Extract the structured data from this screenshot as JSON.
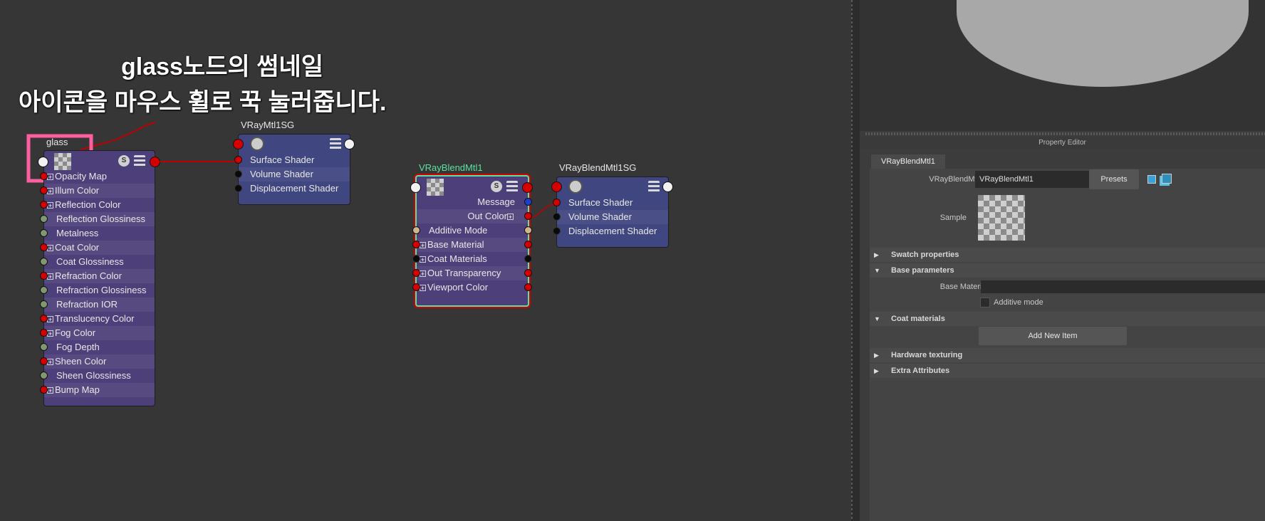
{
  "annotation": {
    "line1": "glass노드의 썸네일",
    "line2": "아이콘을 마우스 휠로 꾹 눌러줍니다."
  },
  "nodes": {
    "glass": {
      "title": "glass",
      "attrs": [
        {
          "label": "Opacity Map",
          "plug": "red",
          "expand": true
        },
        {
          "label": "Illum Color",
          "plug": "red",
          "expand": true
        },
        {
          "label": "Reflection Color",
          "plug": "red",
          "expand": true
        },
        {
          "label": "Reflection Glossiness",
          "plug": "grey",
          "expand": false
        },
        {
          "label": "Metalness",
          "plug": "grey",
          "expand": false
        },
        {
          "label": "Coat Color",
          "plug": "red",
          "expand": true
        },
        {
          "label": "Coat Glossiness",
          "plug": "grey",
          "expand": false
        },
        {
          "label": "Refraction Color",
          "plug": "red",
          "expand": true
        },
        {
          "label": "Refraction Glossiness",
          "plug": "grey",
          "expand": false
        },
        {
          "label": "Refraction IOR",
          "plug": "grey",
          "expand": false
        },
        {
          "label": "Translucency Color",
          "plug": "red",
          "expand": true
        },
        {
          "label": "Fog Color",
          "plug": "red",
          "expand": true
        },
        {
          "label": "Fog Depth",
          "plug": "grey",
          "expand": false
        },
        {
          "label": "Sheen Color",
          "plug": "red",
          "expand": true
        },
        {
          "label": "Sheen Glossiness",
          "plug": "grey",
          "expand": false
        },
        {
          "label": "Bump Map",
          "plug": "red",
          "expand": true
        }
      ]
    },
    "vraymtl1sg": {
      "title": "VRayMtl1SG",
      "attrs": [
        {
          "label": "Surface Shader",
          "plug": "red"
        },
        {
          "label": "Volume Shader",
          "plug": "black"
        },
        {
          "label": "Displacement Shader",
          "plug": "black"
        }
      ]
    },
    "blend": {
      "title": "VRayBlendMtl1",
      "outputs": [
        {
          "label": "Message",
          "plug": "blue",
          "expand": false
        },
        {
          "label": "Out Color",
          "plug": "red",
          "expand": true
        }
      ],
      "attrs": [
        {
          "label": "Additive Mode",
          "plug": "tan",
          "expand": false
        },
        {
          "label": "Base Material",
          "plug": "red",
          "expand": true
        },
        {
          "label": "Coat Materials",
          "plug": "black",
          "expand": true
        },
        {
          "label": "Out Transparency",
          "plug": "red",
          "expand": true
        },
        {
          "label": "Viewport Color",
          "plug": "red",
          "expand": true
        }
      ]
    },
    "blendsg": {
      "title": "VRayBlendMtl1SG",
      "attrs": [
        {
          "label": "Surface Shader",
          "plug": "red"
        },
        {
          "label": "Volume Shader",
          "plug": "black"
        },
        {
          "label": "Displacement Shader",
          "plug": "black"
        }
      ]
    }
  },
  "icons": {
    "shader_s": "S"
  },
  "property_editor": {
    "title": "Property Editor",
    "tab": "VRayBlendMtl1",
    "type_label": "VRayBlendMtl:",
    "name_value": "VRayBlendMtl1",
    "presets_label": "Presets",
    "sample_label": "Sample",
    "sections": {
      "swatch": "Swatch properties",
      "base": "Base parameters",
      "coat": "Coat materials",
      "hardware": "Hardware texturing",
      "extra": "Extra Attributes"
    },
    "base_material_label": "Base Material",
    "additive_mode_label": "Additive mode",
    "add_item_label": "Add New Item"
  },
  "colors": {
    "plug_red": "#d40000",
    "node_purple": "#4c3f7a",
    "node_blue": "#3f4680",
    "highlight_pink": "#ff5f9e",
    "selected_green": "#5ce0a0"
  }
}
